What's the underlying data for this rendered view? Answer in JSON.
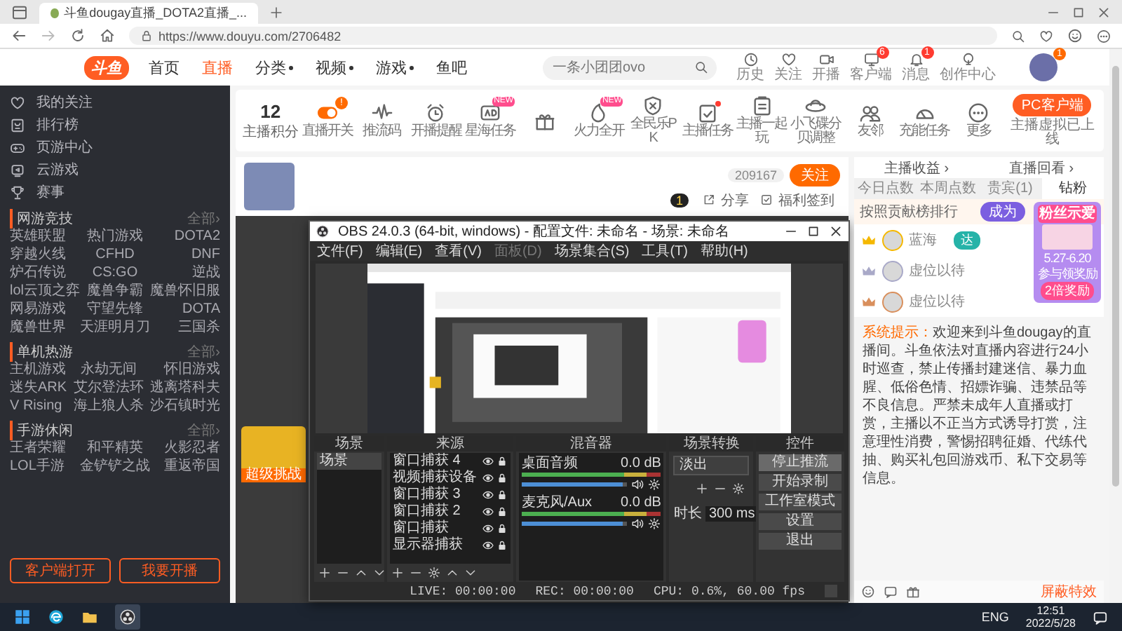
{
  "browser": {
    "tab_title": "斗鱼dougay直播_DOTA2直播_...",
    "url": "https://www.douyu.com/2706482"
  },
  "site_header": {
    "logo": "斗鱼",
    "nav": [
      {
        "label": "首页",
        "selected": false,
        "dropdown": false
      },
      {
        "label": "直播",
        "selected": true,
        "dropdown": false
      },
      {
        "label": "分类",
        "selected": false,
        "dropdown": true
      },
      {
        "label": "视频",
        "selected": false,
        "dropdown": true
      },
      {
        "label": "游戏",
        "selected": false,
        "dropdown": true
      },
      {
        "label": "鱼吧",
        "selected": false,
        "dropdown": false
      }
    ],
    "search": {
      "placeholder": "一条小团团ovo"
    },
    "actions": [
      {
        "label": "历史"
      },
      {
        "label": "关注"
      },
      {
        "label": "开播"
      },
      {
        "label": "客户端",
        "badge": "6"
      },
      {
        "label": "消息",
        "badge": "1"
      },
      {
        "label": "创作中心"
      }
    ],
    "avatar_badge": "1"
  },
  "sidebar": {
    "items": [
      "我的关注",
      "排行榜",
      "页游中心",
      "云游戏",
      "赛事"
    ],
    "sections": [
      {
        "title": "网游竞技",
        "more": "全部›",
        "games": [
          "英雄联盟",
          "热门游戏",
          "DOTA2",
          "穿越火线",
          "CFHD",
          "DNF",
          "炉石传说",
          "CS:GO",
          "逆战",
          "lol云顶之弈",
          "魔兽争霸",
          "魔兽怀旧服",
          "网易游戏",
          "守望先锋",
          "DOTA",
          "魔兽世界",
          "天涯明月刀",
          "三国杀"
        ]
      },
      {
        "title": "单机热游",
        "more": "全部›",
        "games": [
          "主机游戏",
          "永劫无间",
          "怀旧游戏",
          "迷失ARK",
          "艾尔登法环",
          "逃离塔科夫",
          "V Rising",
          "海上狼人杀",
          "沙石镇时光"
        ]
      },
      {
        "title": "手游休闲",
        "more": "全部›",
        "games": [
          "王者荣耀",
          "和平精英",
          "火影忍者",
          "LOL手游",
          "金铲铲之战",
          "重返帝国"
        ]
      }
    ],
    "buttons": [
      "客户端打开",
      "我要开播"
    ]
  },
  "toolbar": {
    "score": "12",
    "score_label": "主播积分",
    "items": [
      {
        "kind": "labeled",
        "label": "直播开关",
        "badge": "!"
      },
      {
        "kind": "labeled",
        "label": "推流码"
      },
      {
        "kind": "labeled",
        "label": "开播提醒"
      },
      {
        "kind": "labeled",
        "label": "星海任务",
        "tag": "NEW"
      },
      {
        "kind": "icon"
      },
      {
        "kind": "labeled",
        "label": "火力全开",
        "tag": "NEW"
      },
      {
        "kind": "labeled",
        "label": "全民乐PK"
      },
      {
        "kind": "labeled",
        "label": "主播任务",
        "dot": true
      },
      {
        "kind": "labeled",
        "label": "主播一起玩"
      },
      {
        "kind": "labeled",
        "label": "小飞碟分贝调整"
      },
      {
        "kind": "labeled",
        "label": "友邻"
      },
      {
        "kind": "labeled",
        "label": "充能任务"
      },
      {
        "kind": "labeled",
        "label": "更多"
      }
    ],
    "pc_button": "PC客户端",
    "pc_note": "主播虚拟已上线"
  },
  "room": {
    "viewer_count": "209167",
    "follow_button": "关注",
    "level_badge": "1",
    "links": [
      "分享",
      "福利签到"
    ],
    "promo_label": "超级挑战"
  },
  "obs": {
    "title": "OBS 24.0.3 (64-bit, windows) - 配置文件: 未命名 - 场景: 未命名",
    "menu": [
      {
        "label": "文件(F)",
        "disabled": false
      },
      {
        "label": "编辑(E)",
        "disabled": false
      },
      {
        "label": "查看(V)",
        "disabled": false
      },
      {
        "label": "面板(D)",
        "disabled": true
      },
      {
        "label": "场景集合(S)",
        "disabled": false
      },
      {
        "label": "工具(T)",
        "disabled": false
      },
      {
        "label": "帮助(H)",
        "disabled": false
      }
    ],
    "docks": [
      "场景",
      "来源",
      "混音器",
      "场景转换",
      "控件"
    ],
    "scenes": [
      {
        "label": "场景",
        "selected": true
      }
    ],
    "sources": [
      "窗口捕获 4",
      "视频捕获设备",
      "窗口捕获 3",
      "窗口捕获 2",
      "窗口捕获",
      "显示器捕获"
    ],
    "mixer": [
      {
        "name": "桌面音频",
        "reading": "0.0 dB",
        "level": 0.95
      },
      {
        "name": "麦克风/Aux",
        "reading": "0.0 dB",
        "level": 0.95
      }
    ],
    "transition": {
      "value": "淡出",
      "duration_label": "时长",
      "duration": "300 ms"
    },
    "controls": [
      {
        "label": "停止推流",
        "active": true
      },
      {
        "label": "开始录制",
        "active": false
      },
      {
        "label": "工作室模式",
        "active": false
      },
      {
        "label": "设置",
        "active": false
      },
      {
        "label": "退出",
        "active": false
      }
    ],
    "status": [
      "LIVE: 00:00:00",
      "REC: 00:00:00",
      "CPU: 0.6%, 60.00 fps"
    ]
  },
  "right_panel": {
    "links": [
      "主播收益 ›",
      "直播回看 ›"
    ],
    "tabs": [
      {
        "label": "今日点数",
        "selected": false
      },
      {
        "label": "本周点数",
        "selected": false
      },
      {
        "label": "贵宾(1)",
        "selected": false
      },
      {
        "label": "钻粉",
        "selected": true
      }
    ],
    "rank_title": "按照贡献榜排行",
    "rank_button": "成为",
    "ranks": [
      {
        "name": "蓝海",
        "color": "#f5b800",
        "tag": "达"
      },
      {
        "name": "虚位以待",
        "color": "#a9a9c8"
      },
      {
        "name": "虚位以待",
        "color": "#d98f5c"
      }
    ],
    "system_label": "系统提示：",
    "system_text": "欢迎来到斗鱼dougay的直播间。斗鱼依法对直播内容进行24小时巡查，禁止传播封建迷信、暴力血腥、低俗色情、招嫖诈骗、违禁品等不良信息。严禁未成年人直播或打赏，主播以不正当方式诱导打赏，注意理性消费，警惕招聘征婚、代练代抽、购买礼包回游戏币、私下交易等信息。",
    "promo": {
      "title": "粉丝示爱",
      "dates": "5.27-6.20",
      "subtitle": "参与领奖励",
      "button": "2倍奖励"
    },
    "bottom_label": "屏蔽特效"
  },
  "taskbar": {
    "lang": "ENG",
    "time": "12:51",
    "date": "2022/5/28"
  }
}
